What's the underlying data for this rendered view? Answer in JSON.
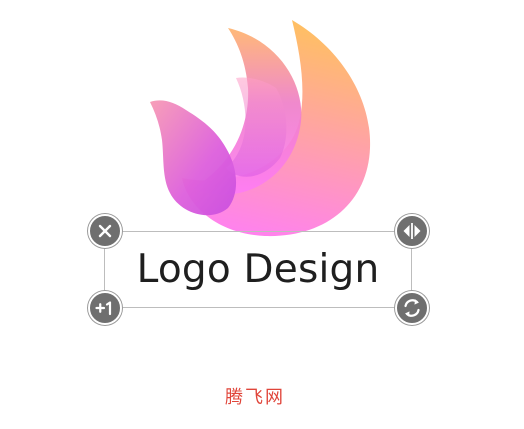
{
  "canvas": {
    "logo_text": "Logo Design",
    "watermark_text": "腾飞网"
  },
  "logo": {
    "icon": "flame-bird-logo-icon",
    "gradient_colors": [
      "#ffbe62",
      "#ff9bb3",
      "#e45ce2",
      "#ff7af5"
    ]
  },
  "handles": {
    "delete_icon": "close-icon",
    "flip_icon": "flip-horizontal-icon",
    "duplicate_icon": "plus-one-icon",
    "rotate_icon": "rotate-icon",
    "handle_color": "#6f6f6f"
  },
  "colors": {
    "selection_border": "#bdbdbd",
    "text": "#1f1f1f",
    "watermark": "#e0453a"
  }
}
